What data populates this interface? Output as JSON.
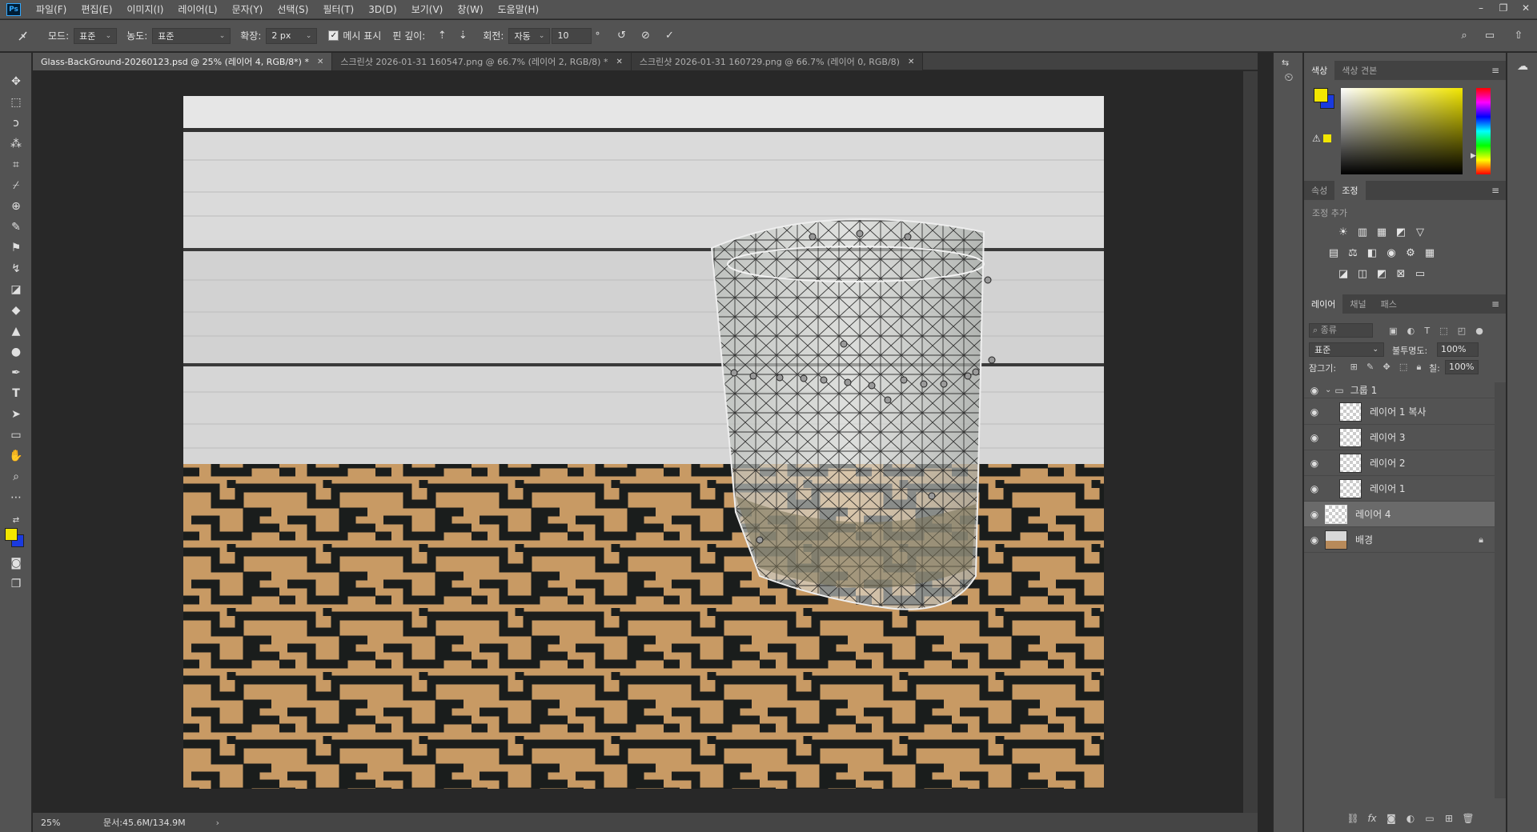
{
  "menu": {
    "app_icon": "Ps",
    "items": [
      "파일(F)",
      "편집(E)",
      "이미지(I)",
      "레이어(L)",
      "문자(Y)",
      "선택(S)",
      "필터(T)",
      "3D(D)",
      "보기(V)",
      "창(W)",
      "도움말(H)"
    ]
  },
  "window_controls": {
    "minimize": "–",
    "restore": "❐",
    "close": "✕"
  },
  "options": {
    "mode_label": "모드:",
    "mode_value": "표준",
    "density_label": "농도:",
    "density_value": "표준",
    "expand_label": "확장:",
    "expand_value": "2 px",
    "show_mesh_label": "메시 표시",
    "show_mesh_checked": true,
    "pin_depth_label": "핀 깊이:",
    "rotate_label": "회전:",
    "rotate_mode": "자동",
    "rotate_value": "10",
    "degree": "°"
  },
  "tabs": [
    {
      "label": "Glass-BackGround-20260123.psd @ 25% (레이어 4, RGB/8*) *",
      "active": true
    },
    {
      "label": "스크린샷 2026-01-31 160547.png @ 66.7% (레이어 2, RGB/8) *",
      "active": false
    },
    {
      "label": "스크린샷 2026-01-31 160729.png @ 66.7% (레이어 0, RGB/8)",
      "active": false
    }
  ],
  "status": {
    "zoom": "25%",
    "doc": "문서:45.6M/134.9M"
  },
  "color_panel": {
    "tabs": [
      "색상",
      "색상 견본"
    ],
    "fg": "#f2e600",
    "bg": "#1a3adf"
  },
  "adjust_panel": {
    "tabs": [
      "속성",
      "조정"
    ],
    "add_label": "조정 추가"
  },
  "layers_panel": {
    "tabs": [
      "레이어",
      "채널",
      "패스"
    ],
    "filter_placeholder": "종류",
    "blend_mode": "표준",
    "opacity_label": "불투명도:",
    "opacity_value": "100%",
    "lock_label": "잠그기:",
    "fill_label": "칠:",
    "fill_value": "100%",
    "layers": [
      {
        "name": "그룹 1",
        "type": "group"
      },
      {
        "name": "레이어 1 복사",
        "type": "layer"
      },
      {
        "name": "레이어 3",
        "type": "layer"
      },
      {
        "name": "레이어 2",
        "type": "layer"
      },
      {
        "name": "레이어 1",
        "type": "layer"
      },
      {
        "name": "레이어 4",
        "type": "layer",
        "selected": true
      },
      {
        "name": "배경",
        "type": "background",
        "locked": true
      }
    ]
  }
}
